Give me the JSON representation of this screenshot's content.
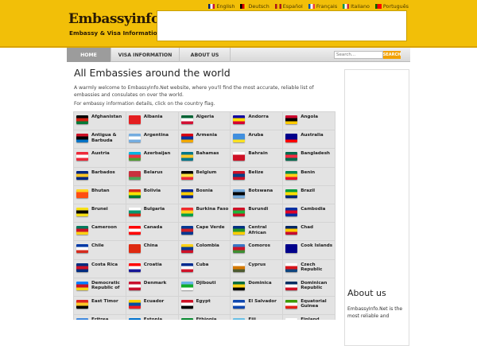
{
  "header": {
    "logo_main": "Embassyinfo.net",
    "logo_sub": "Embassy & Visa Information",
    "languages": [
      {
        "label": "English",
        "colors": [
          "#012169",
          "#ffffff",
          "#c8102e"
        ]
      },
      {
        "label": "Deutsch",
        "colors": [
          "#000000",
          "#dd0000",
          "#ffce00"
        ]
      },
      {
        "label": "Español",
        "colors": [
          "#aa151b",
          "#f1bf00",
          "#aa151b"
        ]
      },
      {
        "label": "Français",
        "colors": [
          "#0055a4",
          "#ffffff",
          "#ef4135"
        ]
      },
      {
        "label": "Italiano",
        "colors": [
          "#009246",
          "#ffffff",
          "#ce2b37"
        ]
      },
      {
        "label": "Português",
        "colors": [
          "#006600",
          "#ff0000",
          "#ff0000"
        ]
      }
    ]
  },
  "nav": {
    "items": [
      "HOME",
      "VISA INFORMATION",
      "ABOUT US"
    ],
    "search_placeholder": "Search...",
    "search_button": "SEARCH"
  },
  "main": {
    "title": "All Embassies around the world",
    "intro": "A warmly welcome to EmbassyInfo.Net website, where you'll find the most accurate, reliable list of embassies and consulates on over the world.",
    "hint": "For embassy information details, click on the country flag."
  },
  "countries": [
    {
      "name": "Afghanistan",
      "flag": [
        "#000000",
        "#d32011",
        "#007a36"
      ]
    },
    {
      "name": "Albania",
      "flag": [
        "#e41e20",
        "#e41e20",
        "#e41e20"
      ]
    },
    {
      "name": "Algeria",
      "flag": [
        "#006233",
        "#ffffff",
        "#d21034"
      ]
    },
    {
      "name": "Andorra",
      "flag": [
        "#10069f",
        "#fedf00",
        "#d50032"
      ]
    },
    {
      "name": "Angola",
      "flag": [
        "#cc092f",
        "#000000",
        "#ffcb00"
      ]
    },
    {
      "name": "Antigua & Barbuda",
      "flag": [
        "#ce1126",
        "#000000",
        "#0072c6"
      ]
    },
    {
      "name": "Argentina",
      "flag": [
        "#74acdf",
        "#ffffff",
        "#74acdf"
      ]
    },
    {
      "name": "Armenia",
      "flag": [
        "#d90012",
        "#0033a0",
        "#f2a800"
      ]
    },
    {
      "name": "Aruba",
      "flag": [
        "#418fde",
        "#418fde",
        "#fbe122"
      ]
    },
    {
      "name": "Australia",
      "flag": [
        "#00008b",
        "#00008b",
        "#ff0000"
      ]
    },
    {
      "name": "Austria",
      "flag": [
        "#ed2939",
        "#ffffff",
        "#ed2939"
      ]
    },
    {
      "name": "Azerbaijan",
      "flag": [
        "#00b5e2",
        "#ef3340",
        "#509e2f"
      ]
    },
    {
      "name": "Bahamas",
      "flag": [
        "#00778b",
        "#ffc72c",
        "#00778b"
      ]
    },
    {
      "name": "Bahrain",
      "flag": [
        "#ffffff",
        "#ce1126",
        "#ce1126"
      ]
    },
    {
      "name": "Bangladesh",
      "flag": [
        "#006a4e",
        "#f42a41",
        "#006a4e"
      ]
    },
    {
      "name": "Barbados",
      "flag": [
        "#00267f",
        "#ffc726",
        "#00267f"
      ]
    },
    {
      "name": "Belarus",
      "flag": [
        "#c8313e",
        "#c8313e",
        "#4aa657"
      ]
    },
    {
      "name": "Belgium",
      "flag": [
        "#000000",
        "#fae042",
        "#ed2939"
      ]
    },
    {
      "name": "Belize",
      "flag": [
        "#ce1126",
        "#003f87",
        "#ce1126"
      ]
    },
    {
      "name": "Benin",
      "flag": [
        "#008751",
        "#fcd116",
        "#e8112d"
      ]
    },
    {
      "name": "Bhutan",
      "flag": [
        "#ffd520",
        "#ff4e12",
        "#ff4e12"
      ]
    },
    {
      "name": "Bolivia",
      "flag": [
        "#d52b1e",
        "#f9e300",
        "#007934"
      ]
    },
    {
      "name": "Bosnia",
      "flag": [
        "#002395",
        "#fecb00",
        "#002395"
      ]
    },
    {
      "name": "Botswana",
      "flag": [
        "#75aadb",
        "#000000",
        "#75aadb"
      ]
    },
    {
      "name": "Brazil",
      "flag": [
        "#009c3b",
        "#ffdf00",
        "#002776"
      ]
    },
    {
      "name": "Brunei",
      "flag": [
        "#f7e017",
        "#000000",
        "#f7e017"
      ]
    },
    {
      "name": "Bulgaria",
      "flag": [
        "#ffffff",
        "#00966e",
        "#d62612"
      ]
    },
    {
      "name": "Burkina Faso",
      "flag": [
        "#ef2b2d",
        "#fcd116",
        "#009e49"
      ]
    },
    {
      "name": "Burundi",
      "flag": [
        "#ce1126",
        "#1eb53a",
        "#ce1126"
      ]
    },
    {
      "name": "Cambodia",
      "flag": [
        "#032ea1",
        "#e00025",
        "#032ea1"
      ]
    },
    {
      "name": "Cameroon",
      "flag": [
        "#007a5e",
        "#ce1126",
        "#fcd116"
      ]
    },
    {
      "name": "Canada",
      "flag": [
        "#ff0000",
        "#ffffff",
        "#ff0000"
      ]
    },
    {
      "name": "Cape Verde",
      "flag": [
        "#003893",
        "#cf2027",
        "#003893"
      ]
    },
    {
      "name": "Central African",
      "flag": [
        "#003082",
        "#289728",
        "#ffce00"
      ]
    },
    {
      "name": "Chad",
      "flag": [
        "#002664",
        "#fecb00",
        "#c60c30"
      ]
    },
    {
      "name": "Chile",
      "flag": [
        "#0039a6",
        "#ffffff",
        "#d52b1e"
      ]
    },
    {
      "name": "China",
      "flag": [
        "#de2910",
        "#de2910",
        "#de2910"
      ]
    },
    {
      "name": "Colombia",
      "flag": [
        "#fcd116",
        "#003893",
        "#ce1126"
      ]
    },
    {
      "name": "Comoros",
      "flag": [
        "#3a75c4",
        "#ce1126",
        "#3d8e33"
      ]
    },
    {
      "name": "Cook Islands",
      "flag": [
        "#00008b",
        "#00008b",
        "#00008b"
      ]
    },
    {
      "name": "Costa Rica",
      "flag": [
        "#002b7f",
        "#ce1126",
        "#002b7f"
      ]
    },
    {
      "name": "Croatia",
      "flag": [
        "#ff0000",
        "#ffffff",
        "#171796"
      ]
    },
    {
      "name": "Cuba",
      "flag": [
        "#002a8f",
        "#ffffff",
        "#cf142b"
      ]
    },
    {
      "name": "Cyprus",
      "flag": [
        "#ffffff",
        "#d57800",
        "#4e5b31"
      ]
    },
    {
      "name": "Czech Republic",
      "flag": [
        "#ffffff",
        "#d7141a",
        "#11457e"
      ]
    },
    {
      "name": "Democratic Republic of",
      "flag": [
        "#007fff",
        "#ce1021",
        "#f7d618"
      ]
    },
    {
      "name": "Denmark",
      "flag": [
        "#c8102e",
        "#ffffff",
        "#c8102e"
      ]
    },
    {
      "name": "Djibouti",
      "flag": [
        "#6ab2e7",
        "#12ad2b",
        "#ffffff"
      ]
    },
    {
      "name": "Dominica",
      "flag": [
        "#006b3f",
        "#fcd116",
        "#000000"
      ]
    },
    {
      "name": "Dominican Republic",
      "flag": [
        "#002d62",
        "#ffffff",
        "#ce1126"
      ]
    },
    {
      "name": "East Timor",
      "flag": [
        "#dc241f",
        "#ffc726",
        "#000000"
      ]
    },
    {
      "name": "Ecuador",
      "flag": [
        "#ffd100",
        "#034ea2",
        "#ed1c24"
      ]
    },
    {
      "name": "Egypt",
      "flag": [
        "#ce1126",
        "#ffffff",
        "#000000"
      ]
    },
    {
      "name": "El Salvador",
      "flag": [
        "#0f47af",
        "#ffffff",
        "#0f47af"
      ]
    },
    {
      "name": "Equatorial Guinea",
      "flag": [
        "#3e9a00",
        "#ffffff",
        "#e32118"
      ]
    },
    {
      "name": "Eritrea",
      "flag": [
        "#4189dd",
        "#ea0437",
        "#12ad2b"
      ]
    },
    {
      "name": "Estonia",
      "flag": [
        "#0072ce",
        "#000000",
        "#ffffff"
      ]
    },
    {
      "name": "Ethiopia",
      "flag": [
        "#078930",
        "#fcdd09",
        "#da121a"
      ]
    },
    {
      "name": "Fiji",
      "flag": [
        "#68bfe5",
        "#68bfe5",
        "#00247d"
      ]
    },
    {
      "name": "Finland",
      "flag": [
        "#ffffff",
        "#003580",
        "#ffffff"
      ]
    }
  ],
  "sidebar": {
    "about_title": "About us",
    "about_text": "EmbassyInfo.Net is the most reliable and"
  }
}
